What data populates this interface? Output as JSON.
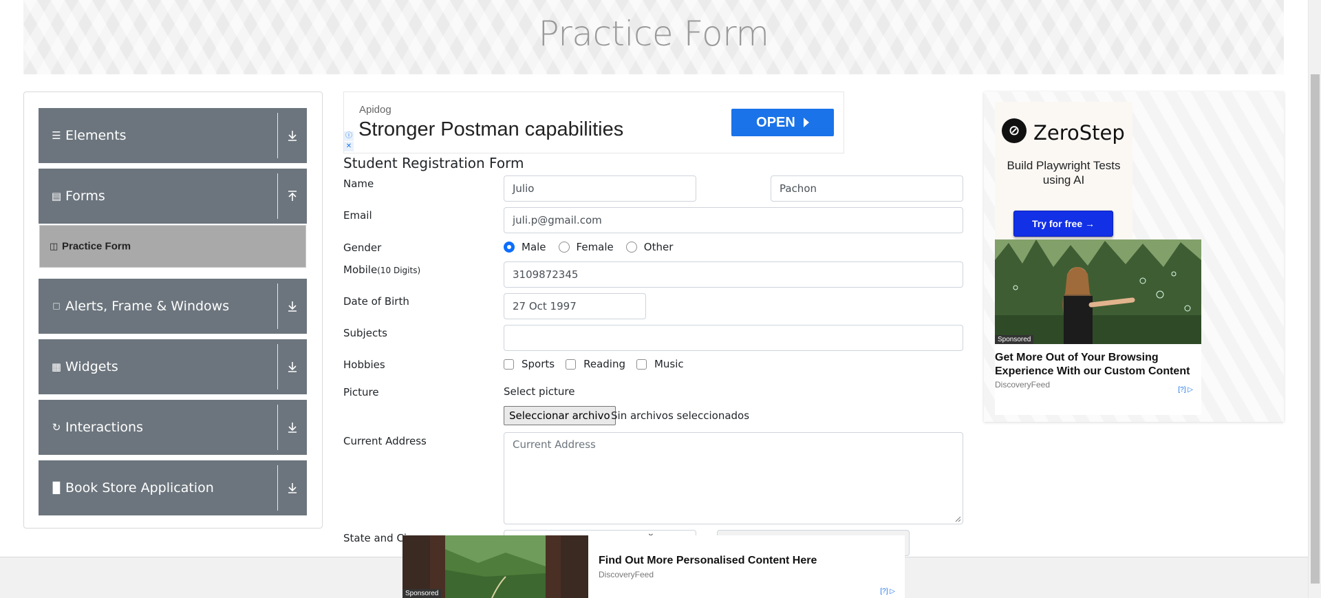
{
  "header": {
    "title": "Practice Form"
  },
  "sidebar": {
    "groups": [
      {
        "label": "Elements",
        "icon": "hamburger-icon",
        "arrow": "download"
      },
      {
        "label": "Forms",
        "icon": "document-icon",
        "arrow": "upload"
      },
      {
        "label": "Alerts, Frame & Windows",
        "icon": "window-icon",
        "arrow": "download"
      },
      {
        "label": "Widgets",
        "icon": "grid-icon",
        "arrow": "download"
      },
      {
        "label": "Interactions",
        "icon": "refresh-icon",
        "arrow": "download"
      },
      {
        "label": "Book Store Application",
        "icon": "books-icon",
        "arrow": "download"
      }
    ],
    "active_item": {
      "label": "Practice Form",
      "icon": "form-icon"
    }
  },
  "ad_top": {
    "brand": "Apidog",
    "headline": "Stronger Postman capabilities",
    "button": "OPEN"
  },
  "form": {
    "title": "Student Registration Form",
    "name_label": "Name",
    "first_name": "Julio",
    "last_name": "Pachon",
    "email_label": "Email",
    "email": "juli.p@gmail.com",
    "gender_label": "Gender",
    "gender_options": [
      "Male",
      "Female",
      "Other"
    ],
    "gender_selected": "Male",
    "mobile_label": "Mobile",
    "mobile_hint": "(10 Digits)",
    "mobile": "3109872345",
    "dob_label": "Date of Birth",
    "dob": "27 Oct 1997",
    "subjects_label": "Subjects",
    "subjects": "",
    "hobbies_label": "Hobbies",
    "hobbies": [
      "Sports",
      "Reading",
      "Music"
    ],
    "picture_label": "Picture",
    "picture_hint": "Select picture",
    "file_button": "Seleccionar archivo",
    "file_status": "Sin archivos seleccionados",
    "address_label": "Current Address",
    "address_placeholder": "Current Address",
    "state_city_label": "State and Ci"
  },
  "ad_right": {
    "brand": "ZeroStep",
    "subtitle": "Build Playwright Tests using AI",
    "button": "Try for free →",
    "sponsored": "Sponsored",
    "card_title": "Get More Out of Your Browsing Experience With our Custom Content",
    "card_brand": "DiscoveryFeed",
    "ad_marker": "[?]"
  },
  "ad_bottom": {
    "title": "Find Out More Personalised Content Here",
    "brand": "DiscoveryFeed",
    "sponsored": "Sponsored",
    "ad_marker": "[?]"
  },
  "colors": {
    "accordion": "#6c757d",
    "active_item": "#a9a9a9",
    "primary": "#0d6efd",
    "ad_button": "#1a73e8",
    "zerostep_button": "#1230e6"
  }
}
